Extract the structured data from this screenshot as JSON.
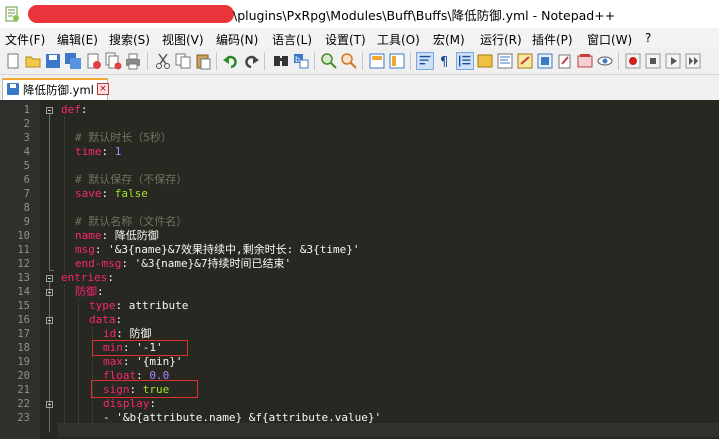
{
  "window": {
    "title": "\\plugins\\PxRpg\\Modules\\Buff\\Buffs\\降低防御.yml - Notepad++"
  },
  "menu": [
    "文件(F)",
    "编辑(E)",
    "搜索(S)",
    "视图(V)",
    "编码(N)",
    "语言(L)",
    "设置(T)",
    "工具(O)",
    "宏(M)",
    "运行(R)",
    "插件(P)",
    "窗口(W)",
    "?"
  ],
  "tab": {
    "label": "降低防御.yml"
  },
  "editor": {
    "line_numbers": [
      "1",
      "2",
      "3",
      "4",
      "5",
      "6",
      "7",
      "8",
      "9",
      "10",
      "11",
      "12",
      "13",
      "14",
      "15",
      "16",
      "17",
      "18",
      "19",
      "20",
      "21",
      "22",
      "23"
    ],
    "code": {
      "l1_key": "def",
      "l3_comment": "# 默认时长（5秒）",
      "l4_key": "time",
      "l4_val": "1",
      "l6_comment": "# 默认保存（不保存）",
      "l7_key": "save",
      "l7_val": "false",
      "l9_comment": "# 默认名称（文件名）",
      "l10_key": "name",
      "l10_val": "降低防御",
      "l11_key": "msg",
      "l11_val": "'&3{name}&7效果持续中,剩余时长: &3{time}'",
      "l12_key": "end-msg",
      "l12_val": "'&3{name}&7持续时间已结束'",
      "l13_key": "entries",
      "l14_key": "防御",
      "l15_key": "type",
      "l15_val": "attribute",
      "l16_key": "data",
      "l17_key": "id",
      "l17_val": "防御",
      "l18_key": "min",
      "l18_val": "'-1'",
      "l19_key": "max",
      "l19_val": "'{min}'",
      "l20_key": "float",
      "l20_val": "0.0",
      "l21_key": "sign",
      "l21_val": "true",
      "l22_key": "display",
      "l23_dash": "- ",
      "l23_val": "'&b{attribute.name} &f{attribute.value}'"
    }
  }
}
